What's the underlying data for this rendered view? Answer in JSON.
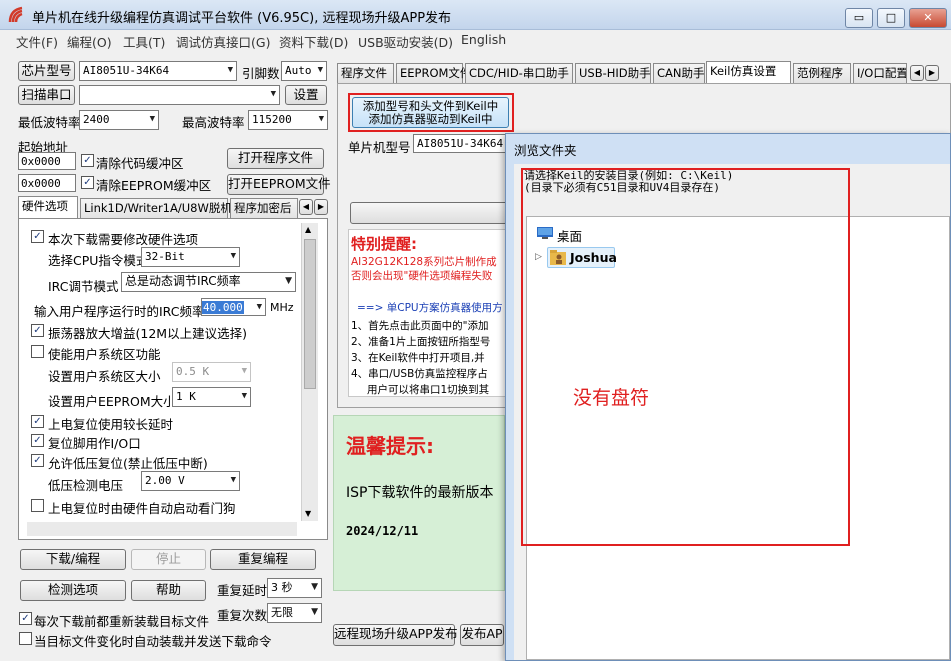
{
  "title": "单片机在线升级编程仿真调试平台软件 (V6.95C), 远程现场升级APP发布",
  "window_buttons": {
    "minimize": "▭",
    "maximize": "□",
    "close": "✕"
  },
  "menu": [
    "文件(F)",
    "编程(O)",
    "工具(T)",
    "调试仿真接口(G)",
    "资料下载(D)",
    "USB驱动安装(D)",
    "English"
  ],
  "left": {
    "chip_button": "芯片型号",
    "chip_value": "AI8051U-34K64",
    "pin_label": "引脚数",
    "pin_value": "Auto",
    "scan_button": "扫描串口",
    "port_value": "",
    "settings_button": "设置",
    "min_baud_label": "最低波特率",
    "min_baud_value": "2400",
    "max_baud_label": "最高波特率",
    "max_baud_value": "115200",
    "start_addr_label": "起始地址",
    "code_addr": "0x0000",
    "clear_code_label": "清除代码缓冲区",
    "open_prog_button": "打开程序文件",
    "eeprom_addr": "0x0000",
    "clear_eeprom_label": "清除EEPROM缓冲区",
    "open_eeprom_button": "打开EEPROM文件",
    "tabs": [
      "硬件选项",
      "Link1D/Writer1A/U8W脱机",
      "程序加密后"
    ],
    "options": {
      "opt1": "本次下载需要修改硬件选项",
      "cpu_label": "选择CPU指令模式",
      "cpu_value": "32-Bit",
      "irc_label": "IRC调节模式",
      "irc_value": "总是动态调节IRC频率",
      "freq_label": "输入用户程序运行时的IRC频率",
      "freq_value": "40.000",
      "freq_unit": "MHz",
      "opt_osc": "振荡器放大增益(12M以上建议选择)",
      "opt_sys": "使能用户系统区功能",
      "sys_size_label": "设置用户系统区大小",
      "sys_size_value": "0.5 K",
      "eeprom_size_label": "设置用户EEPROM大小",
      "eeprom_size_value": "1   K",
      "opt_reset": "上电复位使用较长延时",
      "opt_pin": "复位脚用作I/O口",
      "opt_lowv": "允许低压复位(禁止低压中断)",
      "lowv_label": "低压检测电压",
      "lowv_value": "2.00 V",
      "opt_wdt": "上电复位时由硬件自动启动看门狗"
    },
    "download_button": "下载/编程",
    "stop_button": "停止",
    "repeat_button": "重复编程",
    "detect_button": "检测选项",
    "help_button": "帮助",
    "delay_label": "重复延时",
    "delay_value": "3 秒",
    "count_label": "重复次数",
    "count_value": "无限",
    "reload_label": "每次下载前都重新装载目标文件",
    "auto_label": "当目标文件变化时自动装载并发送下载命令"
  },
  "right": {
    "tabs": [
      "程序文件",
      "EEPROM文件",
      "CDC/HID-串口助手",
      "USB-HID助手",
      "CAN助手",
      "Keil仿真设置",
      "范例程序",
      "I/O口配置"
    ],
    "keil_button_line1": "添加型号和头文件到Keil中",
    "keil_button_line2": "添加仿真器驱动到Keil中",
    "chip_label": "单片机型号",
    "chip_value": "AI8051U-34K64",
    "notice_title": "特别提醒:",
    "notice_line1": "AI32G12K128系列芯片制作成",
    "notice_line2": "否则会出现\"硬件选项编程失败",
    "cpu_line": "==> 单CPU方案仿真器使用方",
    "step1": "1、首先点击此页面中的\"添加",
    "step2": "2、准备1片上面按钮所指型号",
    "step3": "3、在Keil软件中打开项目,并",
    "step4": "4、串口/USB仿真监控程序占",
    "step5": "用户可以将串口1切换到其",
    "tips_title": "温馨提示:",
    "tips_text": "ISP下载软件的最新版本",
    "tips_date": "2024/12/11",
    "remote_button": "远程现场升级APP发布",
    "publish_button": "发布AP"
  },
  "dialog": {
    "title": "浏览文件夹",
    "instr_line1": "请选择Keil的安装目录(例如: C:\\Keil)",
    "instr_line2": "(目录下必须有C51目录和UV4目录存在)",
    "tree": [
      "桌面",
      "Joshua"
    ],
    "annotation": "没有盘符"
  }
}
